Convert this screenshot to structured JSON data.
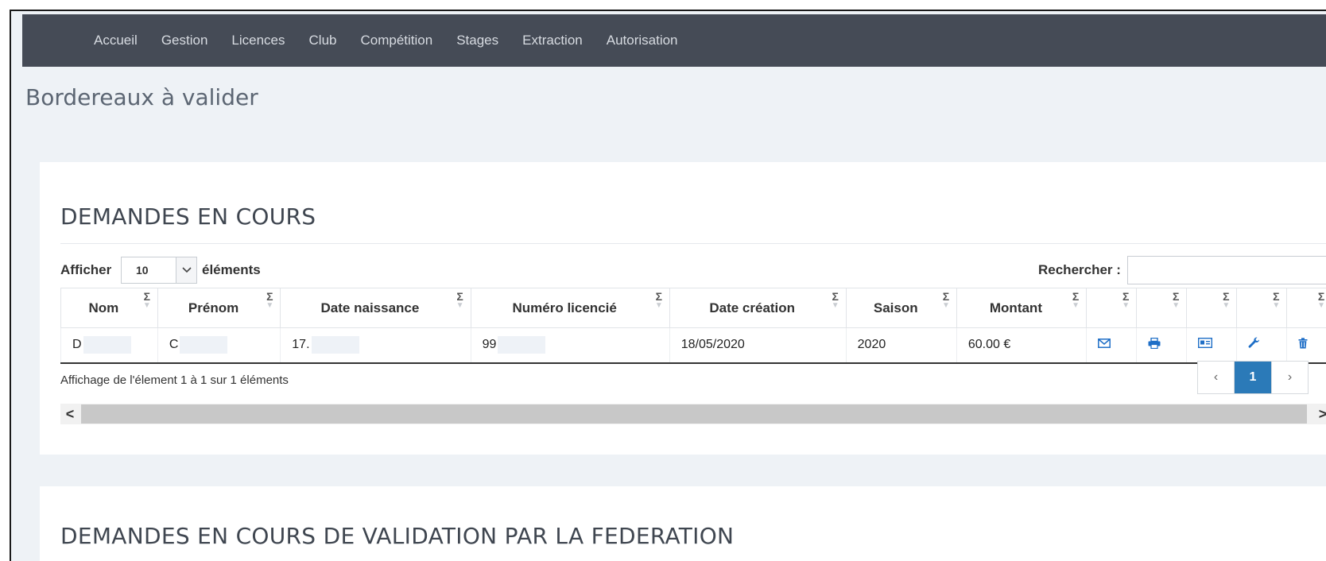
{
  "nav": {
    "items": [
      {
        "label": "Accueil"
      },
      {
        "label": "Gestion"
      },
      {
        "label": "Licences"
      },
      {
        "label": "Club"
      },
      {
        "label": "Compétition"
      },
      {
        "label": "Stages"
      },
      {
        "label": "Extraction"
      },
      {
        "label": "Autorisation"
      }
    ]
  },
  "page": {
    "title": "Bordereaux à valider"
  },
  "panel1": {
    "title": "DEMANDES EN COURS",
    "show_label": "Afficher",
    "length_value": "10",
    "show_suffix": "éléments",
    "search_label": "Rechercher :",
    "search_value": "",
    "columns": [
      "Nom",
      "Prénom",
      "Date naissance",
      "Numéro licencié",
      "Date création",
      "Saison",
      "Montant",
      "",
      "",
      "",
      "",
      ""
    ],
    "rows": [
      {
        "nom": "D",
        "prenom": "C",
        "date_naissance": "17.",
        "numero_licencie": "99",
        "date_creation": "18/05/2020",
        "saison": "2020",
        "montant": "60.00 €",
        "actions": [
          "envelope-icon",
          "print-icon",
          "id-card-icon",
          "wrench-icon",
          "trash-icon"
        ]
      }
    ],
    "info_text": "Affichage de l'élement 1 à 1 sur 1 éléments",
    "pager": {
      "prev": "‹",
      "current": "1",
      "next": "›"
    },
    "scroll": {
      "left": "<",
      "right": ">"
    }
  },
  "panel2": {
    "title": "DEMANDES EN COURS DE VALIDATION PAR LA FEDERATION"
  },
  "colors": {
    "navbar": "#454b56",
    "page_bg": "#eef2f6",
    "accent": "#2b7ab8",
    "icon": "#1f6fc7"
  }
}
